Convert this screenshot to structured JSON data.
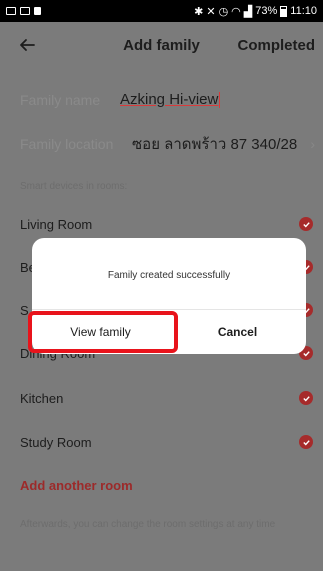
{
  "status_bar": {
    "battery": "73%",
    "time": "11:10"
  },
  "nav": {
    "title": "Add family",
    "action": "Completed"
  },
  "family_name": {
    "label": "Family name",
    "value": "Azking Hi-view"
  },
  "family_location": {
    "label": "Family location",
    "value": "ซอย ลาดพร้าว 87 340/28"
  },
  "rooms_section_label": "Smart devices in rooms:",
  "rooms": [
    {
      "label": "Living Room",
      "checked": true
    },
    {
      "label": "Be",
      "checked": true
    },
    {
      "label": "S",
      "checked": true
    },
    {
      "label": "Dining Room",
      "checked": true
    },
    {
      "label": "Kitchen",
      "checked": true
    },
    {
      "label": "Study Room",
      "checked": true
    }
  ],
  "add_room": "Add another room",
  "hint": "Afterwards, you can change the room settings at any time",
  "dialog": {
    "message": "Family created successfully",
    "primary_button": "View family",
    "secondary_button": "Cancel"
  },
  "colors": {
    "overlay_bg": "#7b7b7b",
    "accent": "#a62b2b",
    "highlight": "#e8131b"
  }
}
